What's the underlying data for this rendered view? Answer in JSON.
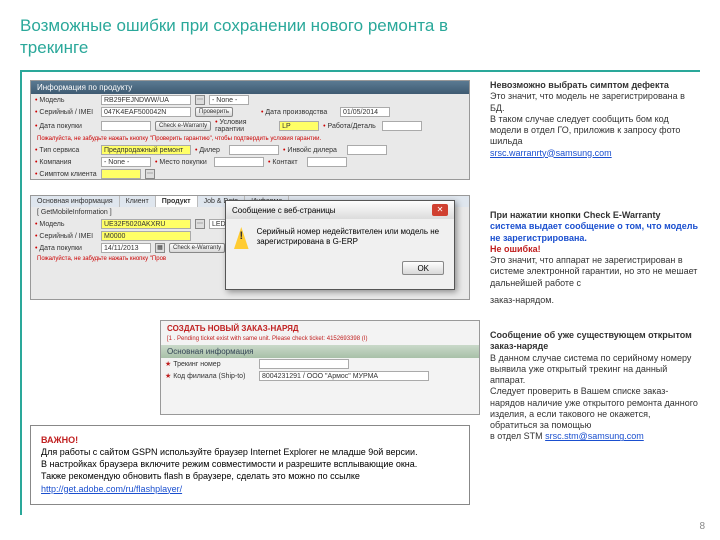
{
  "title": "Возможные ошибки при сохранении нового ремонта в трекинге",
  "page_number": "8",
  "shot1": {
    "header": "Информация по продукту",
    "model_label": "Модель",
    "model_value": "RB29FEJNDWW/UA",
    "model_extra": "- None -",
    "serial_label": "Серийный / IMEI",
    "serial_value": "047K4EAF500042N",
    "serial_btn": "Проверить",
    "mfg_label": "Дата производства",
    "mfg_value": "01/05/2014",
    "buy_label": "Дата покупки",
    "check_btn": "Check e-Warranty",
    "warranty_label": "Условия гарантии",
    "warranty_value": "LP",
    "work_label": "Работа/Деталь",
    "warn": "Пожалуйста, не забудьте нажать кнопку \"Проверить гарантию\", чтобы подтвердить условия гарантии.",
    "ewar_label": "E-Warranty",
    "svc_label": "Тип сервиса",
    "svc_value": "Предпродажный ремонт",
    "dealer_label": "Дилер",
    "dealer_inv_label": "Инвойс дилера",
    "company_label": "Компания",
    "company_value": "- None -",
    "buyplace_label": "Место покупки",
    "contact_label": "Контакт",
    "symptom_label": "Симптом клиента"
  },
  "shot2": {
    "tabs": [
      "Основная информация",
      "Клиент",
      "Продукт",
      "Job & Date",
      "Информа"
    ],
    "getmobile": "[ GetMobileInformation ]",
    "model_label": "Модель",
    "model_value": "UE32F5020AKXRU",
    "model_extra": "LED",
    "serial_label": "Серийный / IMEI",
    "serial_value": "M0000",
    "buy_label": "Дата покупки",
    "buy_value": "14/11/2013",
    "check_btn": "Check e-Warranty",
    "warn": "Пожалуйста, не забудьте нажать кнопку \"Пров"
  },
  "dialog": {
    "title": "Сообщение с веб-страницы",
    "body": "Серийный номер недействителен или модель не зарегистрирована в G-ERP",
    "ok": "OK"
  },
  "shot3": {
    "title": "СОЗДАТЬ НОВЫЙ ЗАКАЗ-НАРЯД",
    "pending": "[1 . Pending ticket exist with same unit. Please check ticket: 4152693398 (I)",
    "section": "Основная информация",
    "track_label": "Трекинг номер",
    "shipto_label": "Код филиала (Ship-to)",
    "shipto_value": "8004231291 / ООО \"Армос\" МУРМА"
  },
  "important": {
    "title": "ВАЖНО!",
    "line1": "Для работы с сайтом GSPN используйте браузер Internet Explorer не младше 9ой версии.",
    "line2": "В настройках браузера включите режим совместимости и разрешите всплывающие окна.",
    "line3": "Также рекомендую обновить flash в браузере, сделать это можно по ссылке",
    "link": "http://get.adobe.com/ru/flashplayer/"
  },
  "rc1": {
    "hd": "Невозможно выбрать симптом дефекта",
    "p1": "Это значит, что модель не зарегистрирована в БД.",
    "p2": "В таком случае следует сообщить бом код модели в отдел ГО, приложив к запросу фото шильда",
    "link": "srsc.warranrty@samsung.com"
  },
  "rc2": {
    "hd": "При нажатии кнопки Check E-Warranty",
    "blue": "система выдает сообщение о том, что модель не зарегистрирована.",
    "noerr": "Не ошибка!",
    "p1": "Это значит, что аппарат не зарегистрирован в системе электронной гарантии, но это не мешает дальнейшей работе с",
    "p2": "заказ-нарядом."
  },
  "rc3": {
    "hd": "Сообщение об уже существующем открытом заказ-наряде",
    "p1": "В данном случае система по серийному номеру выявила уже открытый трекинг на данный аппарат.",
    "p2": "Следует проверить в Вашем списке заказ-нарядов наличие уже открытого ремонта данного изделия, а если такового не окажется, обратиться за помощью",
    "p3": "в отдел STM ",
    "link": "srsc.stm@samsung.com"
  }
}
